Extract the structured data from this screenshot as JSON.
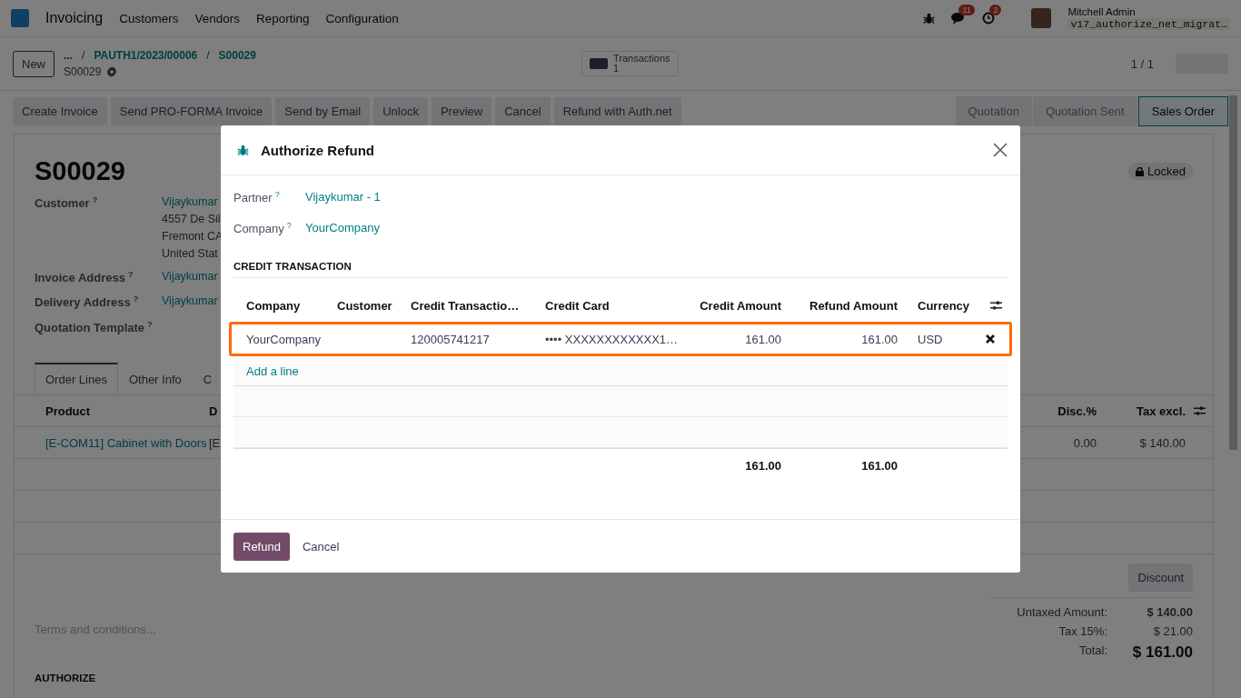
{
  "navbar": {
    "app": "Invoicing",
    "menu": [
      "Customers",
      "Vendors",
      "Reporting",
      "Configuration"
    ],
    "messages_badge": "11",
    "activities_badge": "2",
    "user": "Mitchell Admin",
    "database": "v17_authorize_net_migrat…"
  },
  "control_panel": {
    "new_button": "New",
    "breadcrumbs": [
      "...",
      "PAUTH1/2023/00006",
      "S00029"
    ],
    "separator": "/",
    "record": "S00029",
    "smart_button": {
      "label": "Transactions",
      "count": "1"
    },
    "pager": "1 / 1"
  },
  "actions": [
    "Create Invoice",
    "Send PRO-FORMA Invoice",
    "Send by Email",
    "Unlock",
    "Preview",
    "Cancel",
    "Refund with Auth.net"
  ],
  "stages": [
    {
      "label": "Quotation",
      "selected": false
    },
    {
      "label": "Quotation Sent",
      "selected": false
    },
    {
      "label": "Sales Order",
      "selected": true
    }
  ],
  "sheet": {
    "title": "S00029",
    "badge": "Locked",
    "fields": [
      {
        "label": "Customer",
        "help": "?",
        "lines": [
          "Vijaykumar",
          "4557 De Sil",
          "Fremont CA",
          "United Stat"
        ]
      },
      {
        "label": "Invoice Address",
        "help": "?",
        "lines": [
          "Vijaykumar"
        ]
      },
      {
        "label": "Delivery Address",
        "help": "?",
        "lines": [
          "Vijaykumar"
        ]
      },
      {
        "label": "Quotation Template",
        "help": "?"
      }
    ],
    "tabs": [
      {
        "label": "Order Lines",
        "selected": true
      },
      {
        "label": "Other Info",
        "selected": false
      },
      {
        "label": "C",
        "selected": false
      }
    ],
    "lines_table": {
      "columns": [
        "Product",
        "D",
        "Disc.%",
        "Tax excl."
      ],
      "rows": [
        [
          "[E-COM11] Cabinet with Doors",
          "[E",
          "0.00",
          "$ 140.00"
        ]
      ]
    },
    "discount_button": "Discount",
    "terms_placeholder": "Terms and conditions...",
    "totals": [
      {
        "label": "Untaxed Amount:",
        "value": "$ 140.00",
        "kind": "subtotal"
      },
      {
        "label": "Tax 15%:",
        "value": "$ 21.00",
        "kind": "tax"
      },
      {
        "label": "Total:",
        "value": "$ 161.00",
        "kind": "total"
      }
    ],
    "section": "AUTHORIZE"
  },
  "dialog": {
    "title": "Authorize Refund",
    "fields": [
      {
        "label": "Partner",
        "help": "?",
        "value": "Vijaykumar - 1"
      },
      {
        "label": "Company",
        "help": "?",
        "value": "YourCompany"
      }
    ],
    "section": "CREDIT TRANSACTION",
    "table": {
      "columns": [
        "Company",
        "Customer",
        "Credit Transactio…",
        "Credit Card",
        "Credit Amount",
        "Refund Amount",
        "Currency"
      ],
      "rows": [
        {
          "cells": [
            "YourCompany",
            "",
            "120005741217",
            "•••• XXXXXXXXXXXX1…",
            "161.00",
            "161.00",
            "USD"
          ],
          "highlighted": true
        }
      ],
      "add_line": "Add a line",
      "totals": [
        "161.00",
        "161.00"
      ]
    },
    "buttons": [
      {
        "label": "Refund",
        "kind": "primary"
      },
      {
        "label": "Cancel",
        "kind": "secondary"
      }
    ]
  }
}
